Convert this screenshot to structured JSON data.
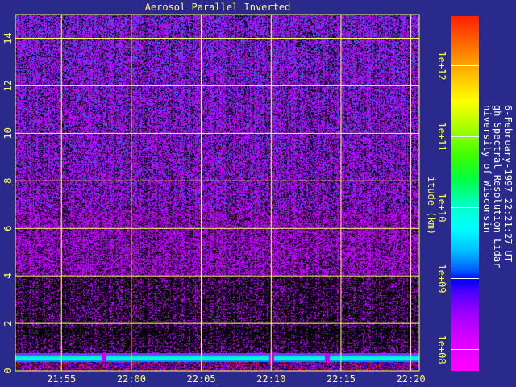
{
  "chart_data": {
    "type": "heatmap",
    "title": "Aerosol Parallel Inverted",
    "ylabel": "itude (km)",
    "xlabel": "",
    "x_ticks": [
      "21:55",
      "22:00",
      "22:05",
      "22:10",
      "22:15",
      "22:20"
    ],
    "x_tick_minutes": [
      0,
      5,
      10,
      15,
      20,
      25
    ],
    "x_range_minutes": [
      -3.3,
      25.6
    ],
    "y_ticks": [
      "0",
      "2",
      "4",
      "6",
      "8",
      "10",
      "12",
      "14"
    ],
    "y_tick_values": [
      0,
      2,
      4,
      6,
      8,
      10,
      12,
      14
    ],
    "ylim": [
      0,
      15
    ],
    "grid": true,
    "colorbar": {
      "scale": "log",
      "range": [
        50000000.0,
        5000000000000.0
      ],
      "ticks": [
        "1e+08",
        "1e+09",
        "1e+10",
        "1e+11",
        "1e+12"
      ],
      "tick_values": [
        100000000.0,
        1000000000.0,
        10000000000.0,
        100000000000.0,
        1000000000000.0
      ]
    },
    "features": {
      "surface_layer_km": [
        0.4,
        0.75
      ],
      "dense_layer_km": [
        0.75,
        1.8
      ],
      "gap_times": [
        "21:58",
        "22:10",
        "22:14"
      ]
    }
  },
  "side_text": [
    "niversity of Wisconsin",
    "gh Spectral Resolution Lidar",
    "6-February-1997 22:21:27 UT"
  ],
  "colors": {
    "background": "#2a2a8c",
    "grid": "#ffff66",
    "text": "#ffff66",
    "side_text": "#ffffff"
  }
}
